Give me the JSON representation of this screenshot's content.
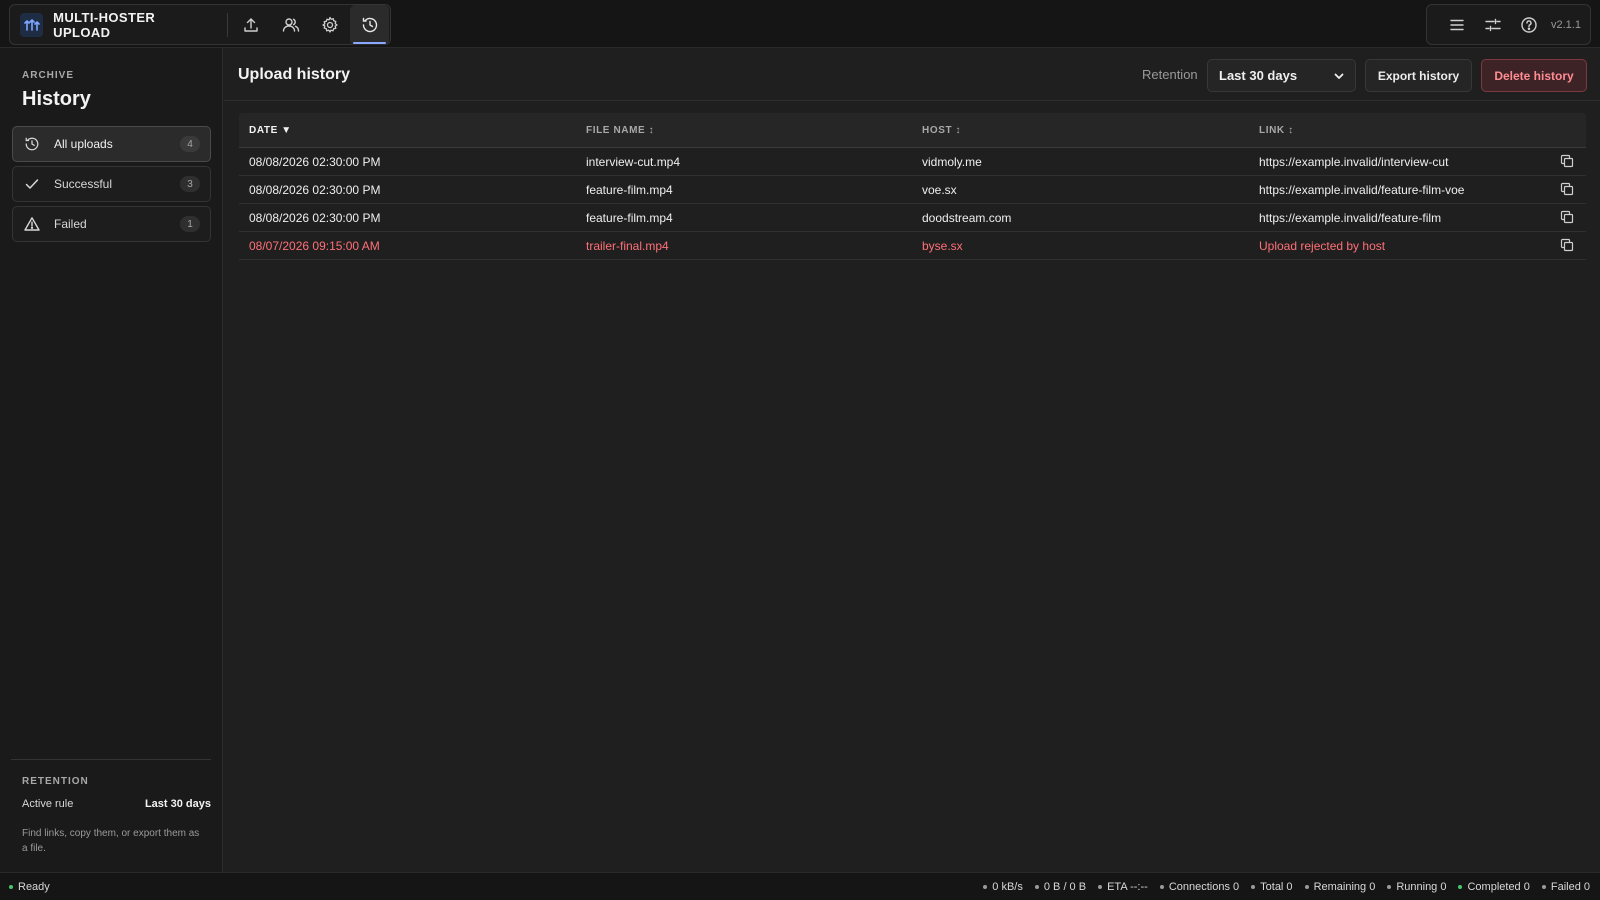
{
  "app": {
    "title": "MULTI-HOSTER UPLOAD",
    "version": "v2.1.1"
  },
  "topnav": {
    "items": [
      {
        "name": "upload",
        "icon": "upload-icon"
      },
      {
        "name": "accounts",
        "icon": "users-icon"
      },
      {
        "name": "settings",
        "icon": "gear-icon"
      },
      {
        "name": "history",
        "icon": "history-icon",
        "active": true
      }
    ],
    "right_icons": [
      "menu-icon",
      "sliders-icon",
      "help-icon"
    ]
  },
  "sidebar": {
    "eyebrow": "ARCHIVE",
    "title": "History",
    "filters": [
      {
        "label": "All uploads",
        "count": "4",
        "icon": "history-icon",
        "active": true
      },
      {
        "label": "Successful",
        "count": "3",
        "icon": "check-icon"
      },
      {
        "label": "Failed",
        "count": "1",
        "icon": "warning-icon"
      }
    ],
    "retention": {
      "eyebrow": "RETENTION",
      "label": "Active rule",
      "value": "Last 30 days",
      "note": "Find links, copy them, or export them as a file."
    }
  },
  "main": {
    "title": "Upload history",
    "retention_label": "Retention",
    "retention_selected": "Last 30 days",
    "export_label": "Export history",
    "delete_label": "Delete history"
  },
  "table": {
    "columns": [
      "DATE ▼",
      "FILE NAME ↕",
      "HOST ↕",
      "LINK ↕"
    ],
    "rows": [
      {
        "date": "08/08/2026 02:30:00 PM",
        "file": "interview-cut.mp4",
        "host": "vidmoly.me",
        "link": "https://example.invalid/interview-cut",
        "status": "ok"
      },
      {
        "date": "08/08/2026 02:30:00 PM",
        "file": "feature-film.mp4",
        "host": "voe.sx",
        "link": "https://example.invalid/feature-film-voe",
        "status": "ok"
      },
      {
        "date": "08/08/2026 02:30:00 PM",
        "file": "feature-film.mp4",
        "host": "doodstream.com",
        "link": "https://example.invalid/feature-film",
        "status": "ok"
      },
      {
        "date": "08/07/2026 09:15:00 AM",
        "file": "trailer-final.mp4",
        "host": "byse.sx",
        "link": "Upload rejected by host",
        "status": "error"
      }
    ]
  },
  "statusbar": {
    "ready": "Ready",
    "speed": "0 kB/s",
    "bytes": "0 B / 0 B",
    "eta": "ETA --:--",
    "connections": "Connections 0",
    "total": "Total 0",
    "remaining": "Remaining 0",
    "running": "Running 0",
    "completed": "Completed 0",
    "failed": "Failed 0"
  },
  "colors": {
    "accent": "#8aa8ff",
    "danger": "#ff7077",
    "success": "#46c46e"
  }
}
